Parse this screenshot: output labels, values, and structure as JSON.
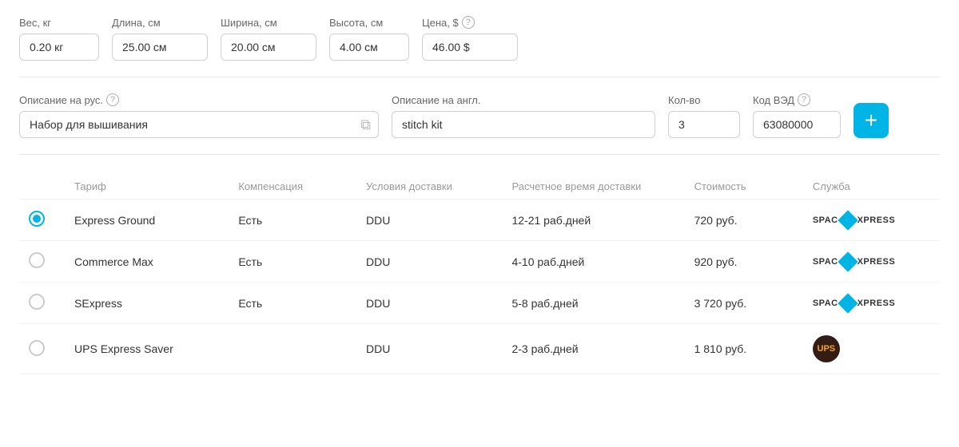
{
  "fields": {
    "weight_label": "Вес, кг",
    "length_label": "Длина, см",
    "width_label": "Ширина, см",
    "height_label": "Высота, см",
    "price_label": "Цена, $",
    "weight_value": "0.20 кг",
    "length_value": "25.00 см",
    "width_value": "20.00 см",
    "height_value": "4.00 см",
    "price_value": "46.00 $"
  },
  "descriptions": {
    "ru_label": "Описание на рус.",
    "en_label": "Описание на англ.",
    "qty_label": "Кол-во",
    "tnved_label": "Код ВЭД",
    "ru_value": "Набор для вышивания",
    "en_value": "stitch kit",
    "qty_value": "3",
    "tnved_value": "63080000",
    "add_label": "+"
  },
  "table": {
    "col_tariff": "Тариф",
    "col_comp": "Компенсация",
    "col_cond": "Условия доставки",
    "col_time": "Расчетное время доставки",
    "col_cost": "Стоимость",
    "col_service": "Служба",
    "rows": [
      {
        "selected": true,
        "tariff": "Express Ground",
        "compensation": "Есть",
        "condition": "DDU",
        "time": "12-21 раб.дней",
        "cost": "720 руб.",
        "service": "spac"
      },
      {
        "selected": false,
        "tariff": "Commerce Max",
        "compensation": "Есть",
        "condition": "DDU",
        "time": "4-10 раб.дней",
        "cost": "920 руб.",
        "service": "spac"
      },
      {
        "selected": false,
        "tariff": "SExpress",
        "compensation": "Есть",
        "condition": "DDU",
        "time": "5-8 раб.дней",
        "cost": "3 720 руб.",
        "service": "spac"
      },
      {
        "selected": false,
        "tariff": "UPS Express Saver",
        "compensation": "",
        "condition": "DDU",
        "time": "2-3 раб.дней",
        "cost": "1 810 руб.",
        "service": "ups"
      }
    ]
  }
}
